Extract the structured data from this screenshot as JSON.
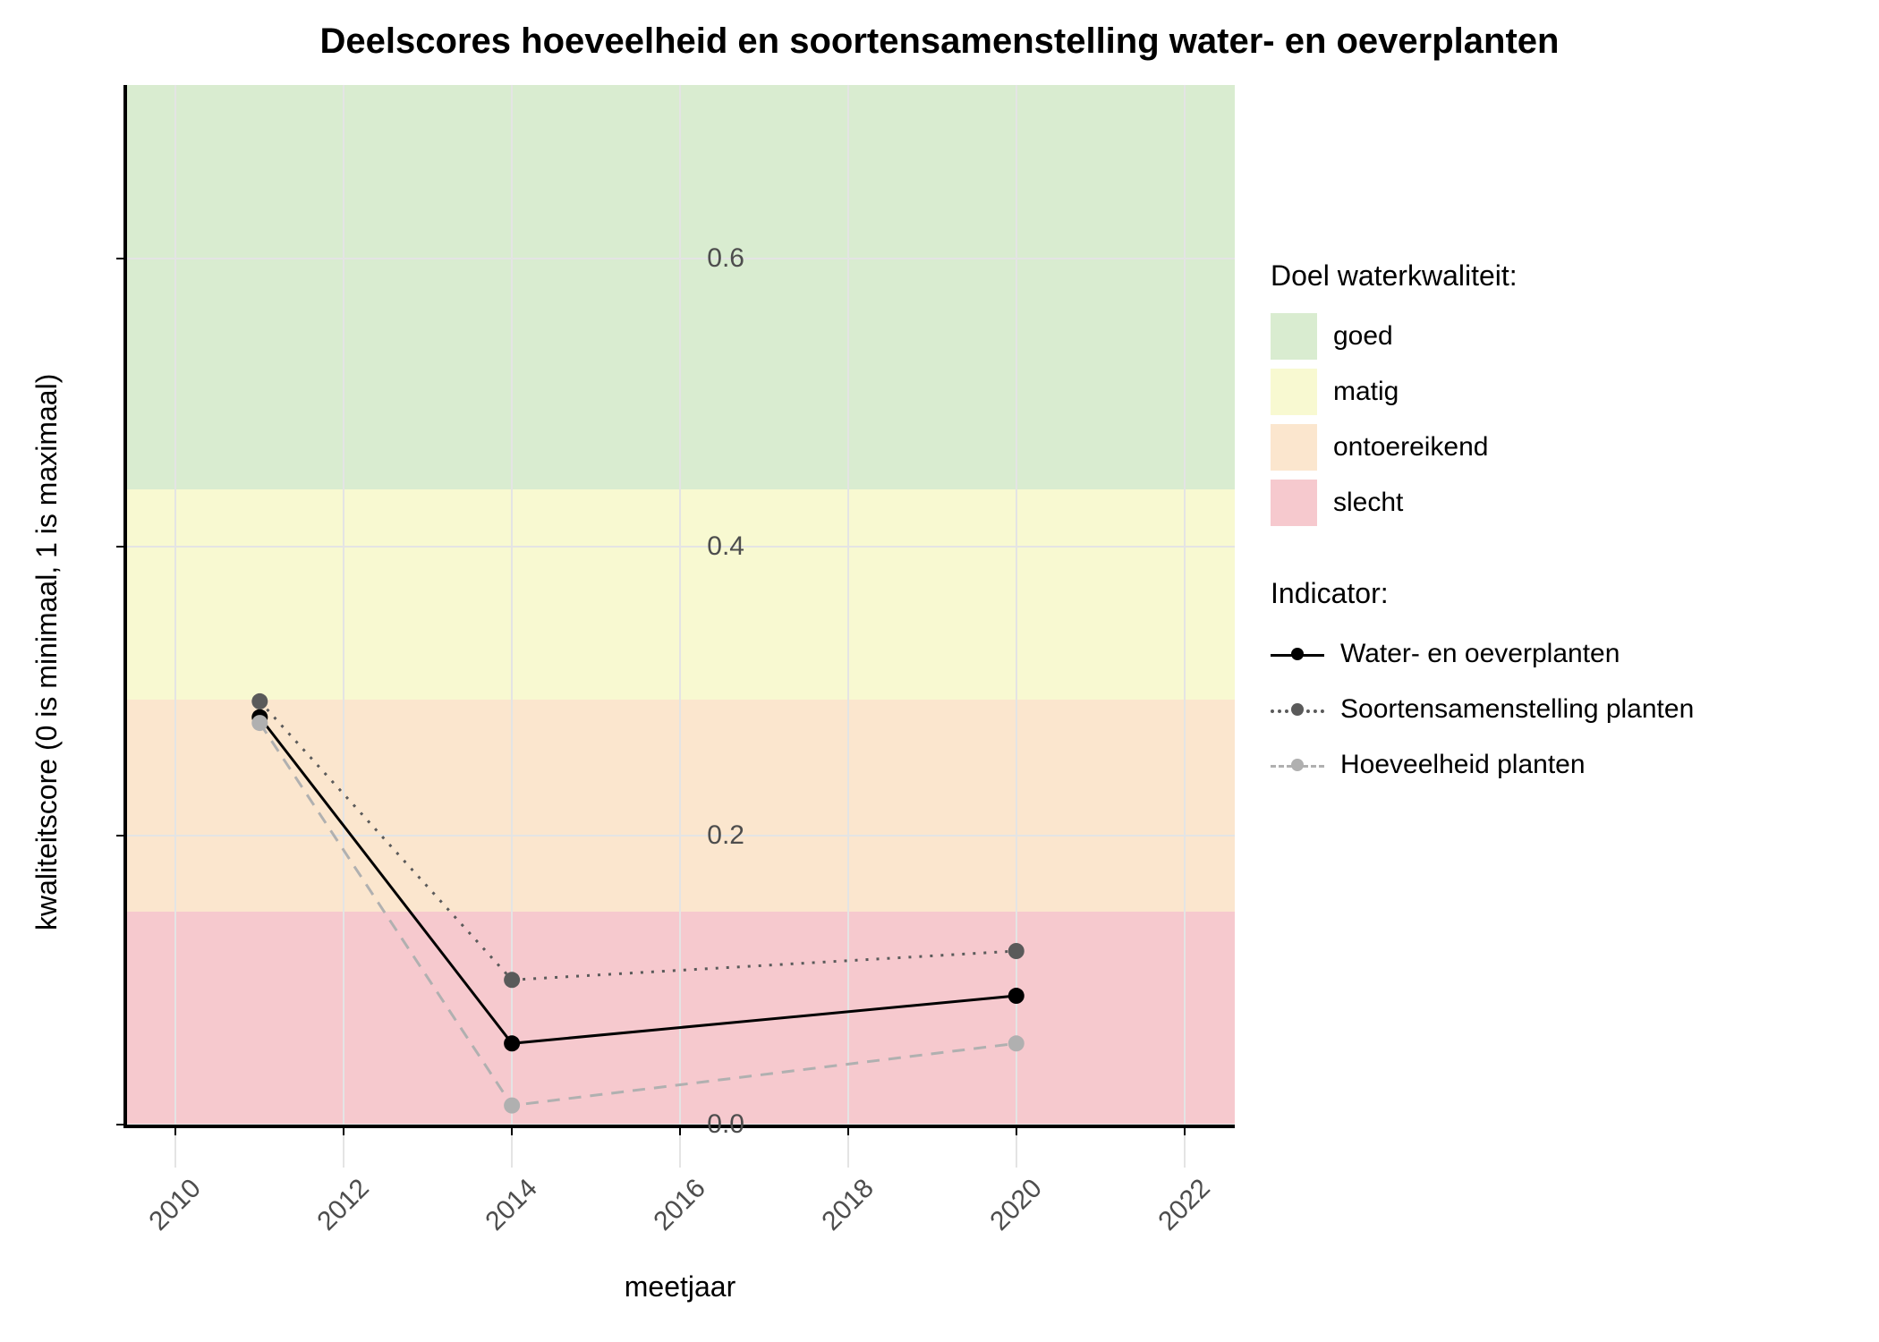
{
  "title": "Deelscores hoeveelheid en soortensamenstelling water- en oeverplanten",
  "xlabel": "meetjaar",
  "ylabel": "kwaliteitscore (0 is minimaal, 1 is maximaal)",
  "x_ticks": [
    "2010",
    "2012",
    "2014",
    "2016",
    "2018",
    "2020",
    "2022"
  ],
  "y_ticks": [
    "0.0",
    "0.2",
    "0.4",
    "0.6"
  ],
  "legend_doel_title": "Doel waterkwaliteit:",
  "legend_doel": {
    "goed": "goed",
    "matig": "matig",
    "ontoereikend": "ontoereikend",
    "slecht": "slecht"
  },
  "legend_ind_title": "Indicator:",
  "legend_ind": {
    "s1": "Water- en oeverplanten",
    "s2": "Soortensamenstelling planten",
    "s3": "Hoeveelheid planten"
  },
  "colors": {
    "goed": "#d9ecd0",
    "matig": "#f8f9d1",
    "ontoereikend": "#fbe6ce",
    "slecht": "#f6c9ce",
    "series1": "#000000",
    "series2": "#5a5a5a",
    "series3": "#b0b0b0"
  },
  "chart_data": {
    "type": "line",
    "title": "Deelscores hoeveelheid en soortensamenstelling water- en oeverplanten",
    "xlabel": "meetjaar",
    "ylabel": "kwaliteitscore (0 is minimaal, 1 is maximaal)",
    "xlim": [
      2009.4,
      2022.6
    ],
    "ylim": [
      -0.03,
      0.72
    ],
    "x": [
      2011,
      2014,
      2020
    ],
    "series": [
      {
        "name": "Water- en oeverplanten",
        "values": [
          0.282,
          0.056,
          0.089
        ],
        "color": "#000000",
        "linestyle": "solid"
      },
      {
        "name": "Soortensamenstelling planten",
        "values": [
          0.293,
          0.1,
          0.12
        ],
        "color": "#5a5a5a",
        "linestyle": "dotted"
      },
      {
        "name": "Hoeveelheid planten",
        "values": [
          0.278,
          0.013,
          0.056
        ],
        "color": "#b0b0b0",
        "linestyle": "dashed"
      }
    ],
    "bands": [
      {
        "name": "slecht",
        "ymin": 0.0,
        "ymax": 0.147,
        "color": "#f6c9ce"
      },
      {
        "name": "ontoereikend",
        "ymin": 0.147,
        "ymax": 0.294,
        "color": "#fbe6ce"
      },
      {
        "name": "matig",
        "ymin": 0.294,
        "ymax": 0.44,
        "color": "#f8f9d1"
      },
      {
        "name": "goed",
        "ymin": 0.44,
        "ymax": 0.72,
        "color": "#d9ecd0"
      }
    ]
  }
}
